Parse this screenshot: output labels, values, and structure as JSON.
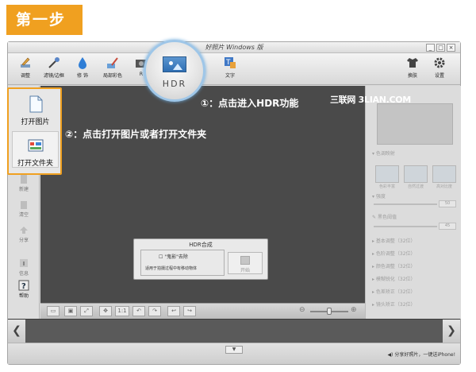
{
  "step_tag": "第一步",
  "window": {
    "title": "好照片 Windows 版",
    "controls": [
      "_",
      "□",
      "×"
    ]
  },
  "toolbar": {
    "left_tools": [
      "调整",
      "滤镜/边框",
      "修 饰",
      "局部彩色",
      "R"
    ],
    "text_tool": "文字",
    "right_tools": [
      "换肤",
      "设置"
    ]
  },
  "hdr_button": {
    "label": "HDR"
  },
  "open_panel": {
    "open_image": "打开图片",
    "open_folder": "打开文件夹"
  },
  "left_panel": {
    "items": [
      "新建",
      "清空",
      "分享",
      "信息",
      "帮助"
    ]
  },
  "annotations": {
    "step1": "①：点击进入HDR功能",
    "step2": "②：点击打开图片或者打开文件夹",
    "watermark": "三联网 3LIAN.COM"
  },
  "dialog": {
    "title": "HDR合成",
    "ghost_removal": "\"鬼影\"去除",
    "description": "适用于拍摄过程中有移动物体",
    "start": "开始"
  },
  "canvas_bar": {
    "zoom_ratio": "1:1",
    "slider_level": 0.5
  },
  "right_panel": {
    "section1": "色调映射",
    "presets": [
      "色彩丰富",
      "自然过渡",
      "高对比度"
    ],
    "strength_label": "强度",
    "strength_value": "50",
    "hdr_label": "黑色阈值",
    "hdr_value": "45",
    "sections": [
      "基本调整（32位）",
      "色阶调整（32位）",
      "颜色调整（32位）",
      "模糊锐化（32位）",
      "色差矫正（32位）",
      "镜头矫正（32位）"
    ]
  },
  "status": {
    "share": "分享好照片，一键送iPhone!"
  }
}
